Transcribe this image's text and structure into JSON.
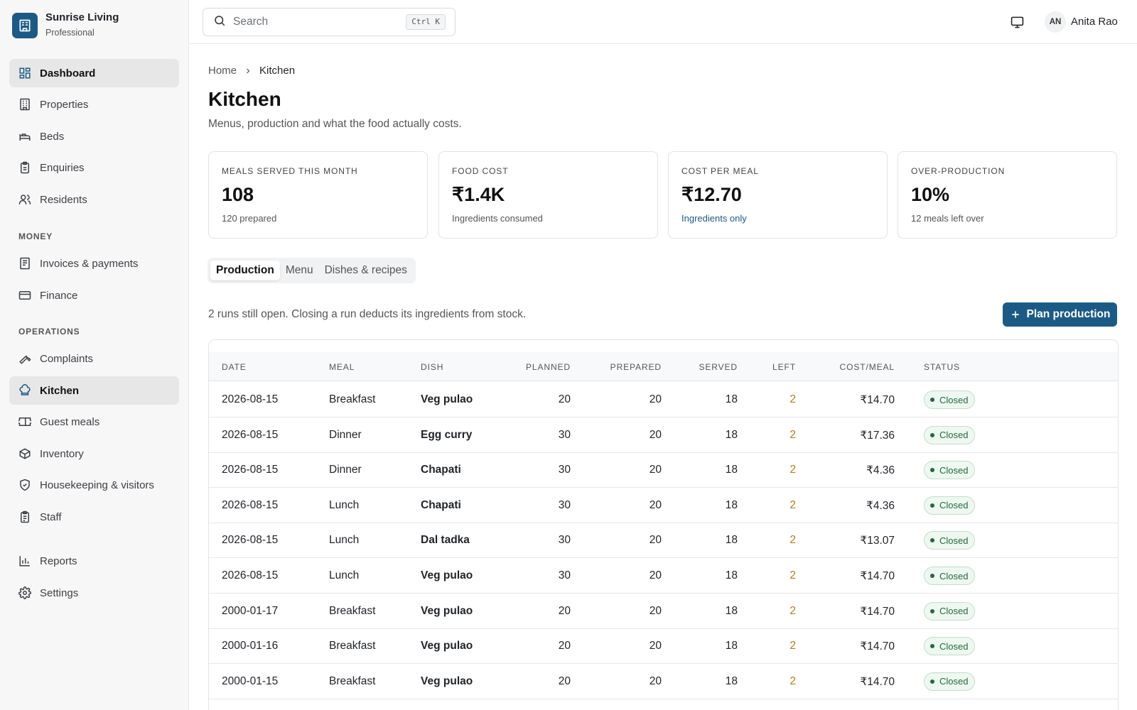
{
  "brand": {
    "name": "Sunrise Living",
    "plan": "Professional",
    "logo_icon": "building-icon"
  },
  "sidebar": {
    "primary": [
      {
        "label": "Dashboard",
        "icon": "dashboard-icon",
        "active": true
      },
      {
        "label": "Properties",
        "icon": "building-icon"
      },
      {
        "label": "Beds",
        "icon": "bed-icon"
      },
      {
        "label": "Enquiries",
        "icon": "clipboard-icon"
      },
      {
        "label": "Residents",
        "icon": "users-icon"
      }
    ],
    "money_heading": "MONEY",
    "money": [
      {
        "label": "Invoices & payments",
        "icon": "receipt-icon"
      },
      {
        "label": "Finance",
        "icon": "credit-card-icon"
      }
    ],
    "operations_heading": "OPERATIONS",
    "operations": [
      {
        "label": "Complaints",
        "icon": "wrench-icon"
      },
      {
        "label": "Kitchen",
        "icon": "chef-hat-icon",
        "active": true
      },
      {
        "label": "Guest meals",
        "icon": "ticket-icon"
      },
      {
        "label": "Inventory",
        "icon": "package-icon"
      },
      {
        "label": "Housekeeping & visitors",
        "icon": "shield-icon"
      },
      {
        "label": "Staff",
        "icon": "clipboard-list-icon"
      }
    ],
    "footer": [
      {
        "label": "Reports",
        "icon": "bar-chart-icon"
      },
      {
        "label": "Settings",
        "icon": "gear-icon"
      }
    ]
  },
  "topbar": {
    "search_placeholder": "Search",
    "shortcut": "Ctrl K",
    "user_initials": "AN",
    "user_name": "Anita Rao"
  },
  "breadcrumb": {
    "home": "Home",
    "current": "Kitchen"
  },
  "page": {
    "title": "Kitchen",
    "subtitle": "Menus, production and what the food actually costs."
  },
  "stats": [
    {
      "label": "MEALS SERVED THIS MONTH",
      "value": "108",
      "note": "120 prepared"
    },
    {
      "label": "FOOD COST",
      "value": "₹1.4K",
      "note": "Ingredients consumed"
    },
    {
      "label": "COST PER MEAL",
      "value": "₹12.70",
      "note": "Ingredients only"
    },
    {
      "label": "OVER-PRODUCTION",
      "value": "10%",
      "note": "12 meals left over"
    }
  ],
  "tabs": [
    "Production",
    "Menu",
    "Dishes & recipes"
  ],
  "notice": "2 runs still open. Closing a run deducts its ingredients from stock.",
  "plan_button": "Plan production",
  "table": {
    "headers": [
      "DATE",
      "MEAL",
      "DISH",
      "PLANNED",
      "PREPARED",
      "SERVED",
      "LEFT",
      "COST/MEAL",
      "STATUS"
    ],
    "rows": [
      [
        "2026-08-15",
        "Breakfast",
        "Veg pulao",
        "20",
        "20",
        "18",
        "2",
        "₹14.70",
        "Closed"
      ],
      [
        "2026-08-15",
        "Dinner",
        "Egg curry",
        "30",
        "20",
        "18",
        "2",
        "₹17.36",
        "Closed"
      ],
      [
        "2026-08-15",
        "Dinner",
        "Chapati",
        "30",
        "20",
        "18",
        "2",
        "₹4.36",
        "Closed"
      ],
      [
        "2026-08-15",
        "Lunch",
        "Chapati",
        "30",
        "20",
        "18",
        "2",
        "₹4.36",
        "Closed"
      ],
      [
        "2026-08-15",
        "Lunch",
        "Dal tadka",
        "30",
        "20",
        "18",
        "2",
        "₹13.07",
        "Closed"
      ],
      [
        "2026-08-15",
        "Lunch",
        "Veg pulao",
        "30",
        "20",
        "18",
        "2",
        "₹14.70",
        "Closed"
      ],
      [
        "2000-01-17",
        "Breakfast",
        "Veg pulao",
        "20",
        "20",
        "18",
        "2",
        "₹14.70",
        "Closed"
      ],
      [
        "2000-01-16",
        "Breakfast",
        "Veg pulao",
        "20",
        "20",
        "18",
        "2",
        "₹14.70",
        "Closed"
      ],
      [
        "2000-01-15",
        "Breakfast",
        "Veg pulao",
        "20",
        "20",
        "18",
        "2",
        "₹14.70",
        "Closed"
      ]
    ]
  },
  "colors": {
    "accent": "#1c5a86",
    "left_value": "#b7791f",
    "status_closed": "#1f6b3a"
  }
}
